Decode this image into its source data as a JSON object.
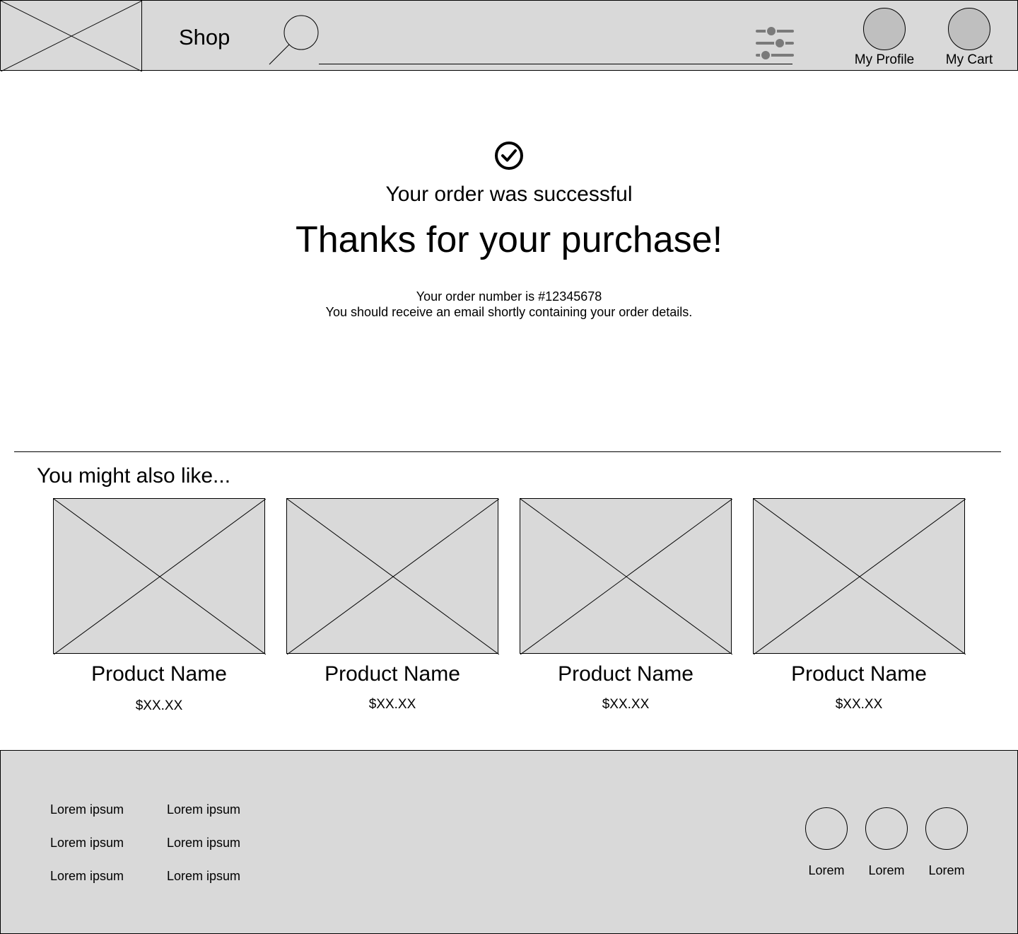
{
  "header": {
    "logo_icon": "image-placeholder-icon",
    "shop_label": "Shop",
    "search_icon": "search-icon",
    "search_placeholder": "",
    "filter_icon": "sliders-icon",
    "profile_label": "My Profile",
    "cart_label": "My Cart"
  },
  "confirmation": {
    "icon": "check-circle-icon",
    "status_text": "Your order was successful",
    "heading": "Thanks for your purchase!",
    "order_number_line": "Your order number is #12345678",
    "email_line": "You should receive an email shortly containing your order details."
  },
  "recommendations": {
    "heading": "You might also like...",
    "products": [
      {
        "name": "Product Name",
        "price": "$XX.XX"
      },
      {
        "name": "Product Name",
        "price": "$XX.XX"
      },
      {
        "name": "Product Name",
        "price": "$XX.XX"
      },
      {
        "name": "Product Name",
        "price": "$XX.XX"
      }
    ]
  },
  "footer": {
    "links_col1": [
      "Lorem ipsum",
      "Lorem ipsum",
      "Lorem ipsum"
    ],
    "links_col2": [
      "Lorem ipsum",
      "Lorem ipsum",
      "Lorem ipsum"
    ],
    "social": [
      {
        "label": "Lorem"
      },
      {
        "label": "Lorem"
      },
      {
        "label": "Lorem"
      }
    ]
  },
  "colors": {
    "panel_gray": "#d9d9d9",
    "avatar_gray": "#bfbfbf",
    "icon_gray": "#7a7a7a",
    "line_black": "#000000"
  }
}
